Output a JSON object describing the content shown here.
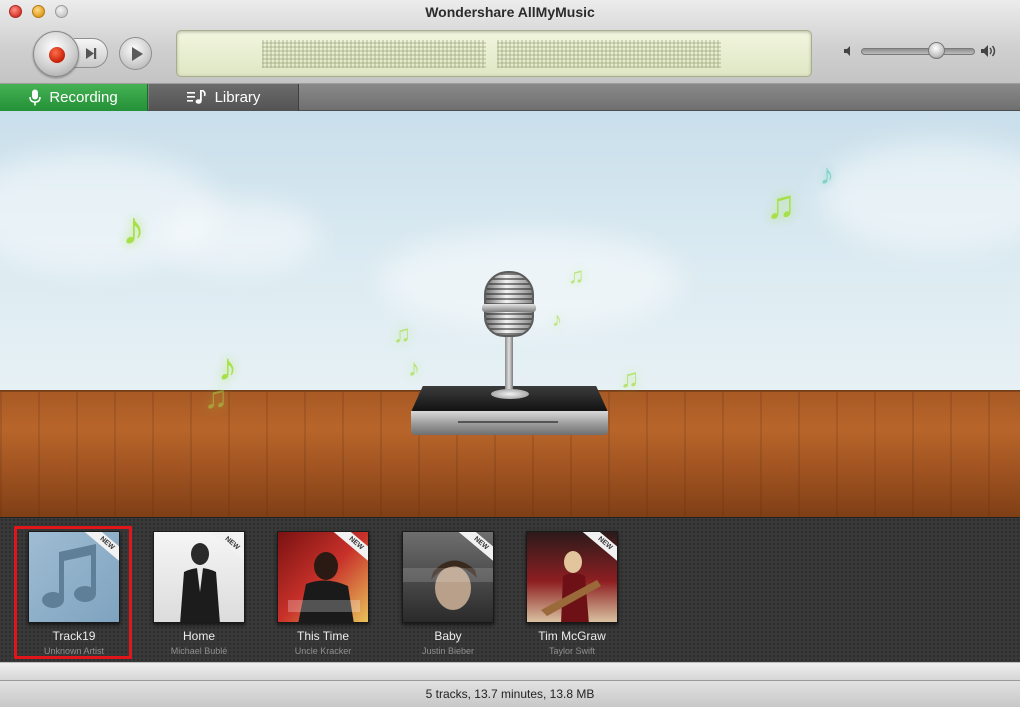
{
  "window": {
    "title": "Wondershare AllMyMusic"
  },
  "toolbar": {
    "record_icon": "record-icon",
    "skip_icon": "skip-forward-icon",
    "play_icon": "play-icon",
    "volume": 0.66
  },
  "tabs": [
    {
      "label": "Recording",
      "icon": "microphone-icon",
      "active": true
    },
    {
      "label": "Library",
      "icon": "music-list-icon",
      "active": false
    }
  ],
  "tracks": [
    {
      "title": "Track19",
      "artist": "Unknown Artist",
      "badge": "NEW",
      "selected": true
    },
    {
      "title": "Home",
      "artist": "Michael Bublé",
      "badge": "NEW",
      "selected": false
    },
    {
      "title": "This Time",
      "artist": "Uncle Kracker",
      "badge": "NEW",
      "selected": false
    },
    {
      "title": "Baby",
      "artist": "Justin Bieber",
      "badge": "NEW",
      "selected": false
    },
    {
      "title": "Tim McGraw",
      "artist": "Taylor Swift",
      "badge": "NEW",
      "selected": false
    }
  ],
  "status": {
    "summary": "5 tracks, 13.7 minutes, 13.8 MB"
  },
  "colors": {
    "accent_green": "#2f9c3f",
    "selection_red": "#e0161a",
    "record_red": "#c41f07"
  }
}
